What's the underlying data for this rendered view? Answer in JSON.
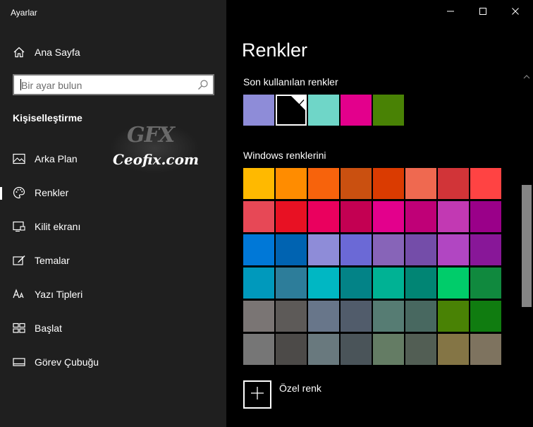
{
  "app": {
    "title": "Ayarlar"
  },
  "sidebar": {
    "home_label": "Ana Sayfa",
    "search_placeholder": "Bir ayar bulun",
    "section_title": "Kişiselleştirme",
    "items": [
      {
        "label": "Arka Plan",
        "icon": "picture-icon"
      },
      {
        "label": "Renkler",
        "icon": "palette-icon",
        "active": true
      },
      {
        "label": "Kilit ekranı",
        "icon": "lock-screen-icon"
      },
      {
        "label": "Temalar",
        "icon": "themes-icon"
      },
      {
        "label": "Yazı Tipleri",
        "icon": "fonts-icon"
      },
      {
        "label": "Başlat",
        "icon": "start-icon"
      },
      {
        "label": "Görev Çubuğu",
        "icon": "taskbar-icon"
      }
    ]
  },
  "watermark": {
    "logo": "GFX",
    "site": "Ceofix.com"
  },
  "main": {
    "title": "Renkler",
    "recent_title": "Son kullanılan renkler",
    "recent_colors": [
      "#8e8cd8",
      "#000000",
      "#6fd6c8",
      "#e3008c",
      "#498205"
    ],
    "recent_selected_index": 1,
    "windows_title": "Windows renklerini",
    "windows_colors": [
      [
        "#ffb900",
        "#ff8c00",
        "#f7630c",
        "#ca5010",
        "#da3b01",
        "#ef6950",
        "#d13438",
        "#ff4343"
      ],
      [
        "#e74856",
        "#e81123",
        "#ea005e",
        "#c30052",
        "#e3008c",
        "#bf0077",
        "#c239b3",
        "#9a0089"
      ],
      [
        "#0078d7",
        "#0063b1",
        "#8e8cd8",
        "#6b69d6",
        "#8764b8",
        "#744da9",
        "#b146c2",
        "#881798"
      ],
      [
        "#0099bc",
        "#2d7d9a",
        "#00b7c3",
        "#038387",
        "#00b294",
        "#018574",
        "#00cc6a",
        "#10893e"
      ],
      [
        "#7a7574",
        "#5d5a58",
        "#68768a",
        "#515c6b",
        "#567c73",
        "#486860",
        "#498205",
        "#107c10"
      ],
      [
        "#767676",
        "#4c4a48",
        "#69797e",
        "#4a5459",
        "#647c64",
        "#525e54",
        "#847545",
        "#7e735f"
      ]
    ],
    "custom_color_label": "Özel renk"
  },
  "window_controls": {
    "minimize": "minimize-icon",
    "maximize": "maximize-icon",
    "close": "close-icon"
  }
}
